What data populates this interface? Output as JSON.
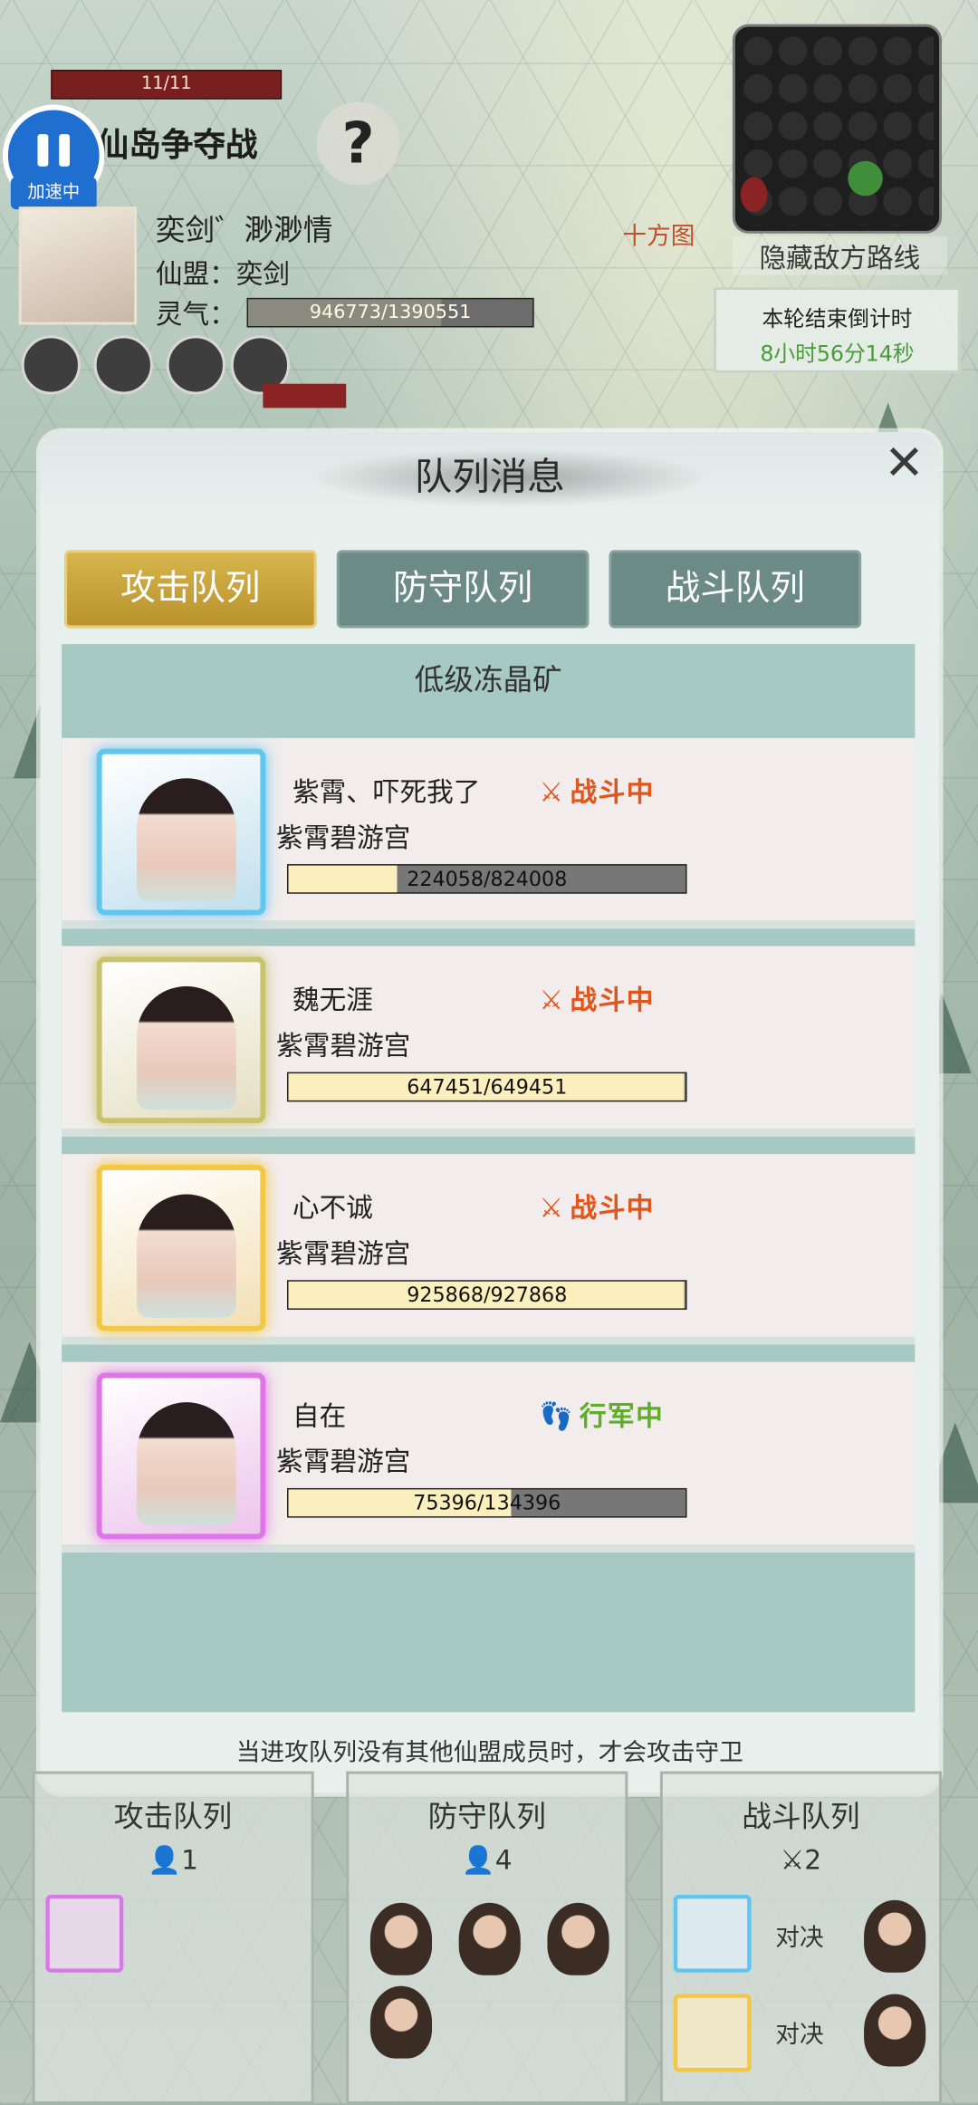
{
  "hud": {
    "hp_text": "11/11",
    "speed_label": "加速中",
    "battle_title": "仙岛争夺战",
    "help_label": "?",
    "player_name": "奕剑゛渺渺情",
    "alliance": "仙盟：奕剑",
    "qi_label": "灵气：",
    "qi_value": "946773/1390551",
    "qi_fraction": 0.68,
    "hide_route": "隐藏敌方路线",
    "map_label": "十方图",
    "timer_title": "本轮结束倒计时",
    "timer_value": "8小时56分14秒"
  },
  "modal": {
    "title": "队列消息",
    "tabs": [
      "攻击队列",
      "防守队列",
      "战斗队列"
    ],
    "mine": "低级冻晶矿",
    "footnote": "当进攻队列没有其他仙盟成员时，才会攻击守卫",
    "members": [
      {
        "name": "紫霄、吓死我了",
        "guild": "紫霄碧游宫",
        "status": "战斗中",
        "hp": "224058/824008",
        "fraction": 0.272,
        "frame": "#5fc6ef",
        "status_color": "#e0561c"
      },
      {
        "name": "魏无涯",
        "guild": "紫霄碧游宫",
        "status": "战斗中",
        "hp": "647451/649451",
        "fraction": 0.997,
        "frame": "#c9c46b",
        "status_color": "#e0561c"
      },
      {
        "name": "心不诚",
        "guild": "紫霄碧游宫",
        "status": "战斗中",
        "hp": "925868/927868",
        "fraction": 0.998,
        "frame": "#f2c744",
        "status_color": "#e0561c"
      },
      {
        "name": "自在",
        "guild": "紫霄碧游宫",
        "status": "行军中",
        "hp": "75396/134396",
        "fraction": 0.561,
        "frame": "#e075e8",
        "status_color": "#5fae2a"
      }
    ]
  },
  "queues": {
    "attack": {
      "title": "攻击队列",
      "count": "1"
    },
    "defend": {
      "title": "防守队列",
      "count": "4"
    },
    "battle": {
      "title": "战斗队列",
      "count": "2",
      "duel1": "对决",
      "duel2": "对决"
    }
  },
  "colors": {
    "active_tab": "#c9a43a",
    "inactive_tab": "#6c8a86",
    "fighting": "#e0561c",
    "marching": "#5fae2a"
  }
}
